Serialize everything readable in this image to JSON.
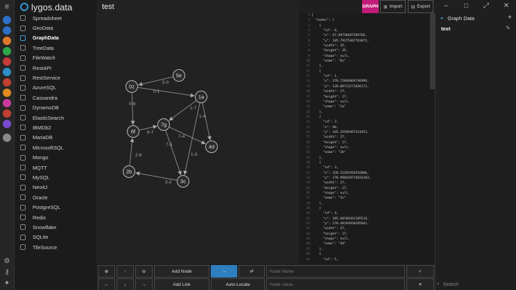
{
  "app": {
    "brand": "lygos.data",
    "doc_title": "test"
  },
  "toolbar": {
    "graph": "GRAPH",
    "import": "Import",
    "export": "Export"
  },
  "nav": {
    "items": [
      {
        "label": "Spreadsheet",
        "icon": "grid-icon",
        "active": false
      },
      {
        "label": "GeoData",
        "icon": "pin-icon",
        "active": false
      },
      {
        "label": "GraphData",
        "icon": "graph-icon",
        "active": true
      },
      {
        "label": "TreeData",
        "icon": "tree-icon",
        "active": false
      },
      {
        "label": "FileWatch",
        "icon": "file-icon",
        "active": false
      },
      {
        "label": "RestAPI",
        "icon": "api-icon",
        "active": false
      },
      {
        "label": "RestService",
        "icon": "service-icon",
        "active": false
      },
      {
        "label": "AzureSQL",
        "icon": "azure-icon",
        "active": false
      },
      {
        "label": "Cassandra",
        "icon": "cassandra-icon",
        "active": false
      },
      {
        "label": "DynamoDB",
        "icon": "dynamodb-icon",
        "active": false
      },
      {
        "label": "ElasticSearch",
        "icon": "elastic-icon",
        "active": false
      },
      {
        "label": "IBMDb2",
        "icon": "ibm-icon",
        "active": false
      },
      {
        "label": "MariaDB",
        "icon": "mariadb-icon",
        "active": false
      },
      {
        "label": "MicrosoftSQL",
        "icon": "mssql-icon",
        "active": false
      },
      {
        "label": "Mongo",
        "icon": "mongo-icon",
        "active": false
      },
      {
        "label": "MQTT",
        "icon": "mqtt-icon",
        "active": false
      },
      {
        "label": "MySQL",
        "icon": "mysql-icon",
        "active": false
      },
      {
        "label": "Neo4J",
        "icon": "neo4j-icon",
        "active": false
      },
      {
        "label": "Oracle",
        "icon": "oracle-icon",
        "active": false
      },
      {
        "label": "PostgreSQL",
        "icon": "postgres-icon",
        "active": false
      },
      {
        "label": "Redis",
        "icon": "redis-icon",
        "active": false
      },
      {
        "label": "Snowflake",
        "icon": "snowflake-icon",
        "active": false
      },
      {
        "label": "SQLite",
        "icon": "sqlite-icon",
        "active": false
      },
      {
        "label": "TileSource",
        "icon": "tile-icon",
        "active": false
      }
    ]
  },
  "graph": {
    "nodes": [
      {
        "name": "0z"
      },
      {
        "name": "1a"
      },
      {
        "name": "2b"
      },
      {
        "name": "3c"
      },
      {
        "name": "4d"
      },
      {
        "name": "5e"
      },
      {
        "name": "6f"
      },
      {
        "name": "7g"
      }
    ],
    "edges": [
      {
        "label": "5-0"
      },
      {
        "label": "0-1"
      },
      {
        "label": "0-6"
      },
      {
        "label": "1-7"
      },
      {
        "label": "1-4"
      },
      {
        "label": "1-3"
      },
      {
        "label": "6-7"
      },
      {
        "label": "7-4"
      },
      {
        "label": "7-3"
      },
      {
        "label": "2-6"
      },
      {
        "label": "3-2"
      }
    ]
  },
  "code": {
    "line_numbers": [
      "1",
      "2",
      "3",
      "4",
      "5",
      "6",
      "7",
      "8",
      "9",
      "10",
      "11",
      "12",
      "13",
      "14",
      "15",
      "16",
      "17",
      "18",
      "19",
      "20",
      "21",
      "22",
      "23",
      "24",
      "25",
      "26",
      "27",
      "28",
      "29",
      "30",
      "31",
      "32",
      "33",
      "34",
      "35",
      "36",
      "37",
      "38",
      "39",
      "40",
      "41",
      "42",
      "43",
      "44",
      "45",
      "46",
      "47",
      "48",
      "49"
    ],
    "lines": [
      "{",
      "  \"nodes\": [",
      "    {",
      "      \"id\": 0,",
      "      \"x\": 67.09756697589766,",
      "      \"y\": 185.79275467763072,",
      "      \"width\": 35,",
      "      \"height\": 35,",
      "      \"shape\": null,",
      "      \"name\": \"0z\"",
      "    },",
      "    {",
      "      \"id\": 1,",
      "      \"x\": 370.72846864746996,",
      "      \"y\": 128.09713271826172,",
      "      \"width\": 27,",
      "      \"height\": 27,",
      "      \"shape\": null,",
      "      \"name\": \"1a\"",
      "    },",
      "    {",
      "      \"id\": 2,",
      "      \"x\": 90,",
      "      \"y\": 345.35599497314453,",
      "      \"width\": 27,",
      "      \"height\": 27,",
      "      \"shape\": null,",
      "      \"name\": \"2b\"",
      "    },",
      "    {",
      "      \"id\": 3,",
      "      \"x\": 338.52292916516806,",
      "      \"y\": 270.990428715033203,",
      "      \"width\": 27,",
      "      \"height\": 27,",
      "      \"shape\": null,",
      "      \"name\": \"3c\"",
      "    },",
      "    {",
      "      \"id\": 4,",
      "      \"x\": 385.60709361105516,",
      "      \"y\": 278.49294930195661,",
      "      \"width\": 27,",
      "      \"height\": 27,",
      "      \"shape\": null,",
      "      \"name\": \"4d\"",
      "    },",
      "    {",
      "      \"id\": 5,"
    ]
  },
  "panel": {
    "title": "Graph Data",
    "entry": "test",
    "search_placeholder": "Search"
  },
  "bottom": {
    "add_node": "Add Node",
    "add_link": "Add Link",
    "auto_locate": "Auto-Locate",
    "node_name_placeholder": "Node Name",
    "node_value_placeholder": "Node Value"
  },
  "colors": {
    "accent": "#2f7fbf",
    "graph_button": "#c21b7a",
    "rail_icons": [
      "#2e6fc9",
      "#2e6fc9",
      "#e0782c",
      "#2fa84a",
      "#c83b3b",
      "#2e8fc9",
      "#c2402f",
      "#e08a20",
      "#c83b9c",
      "#c2402f",
      "#7a4bd0",
      "#8a8a8a"
    ]
  }
}
